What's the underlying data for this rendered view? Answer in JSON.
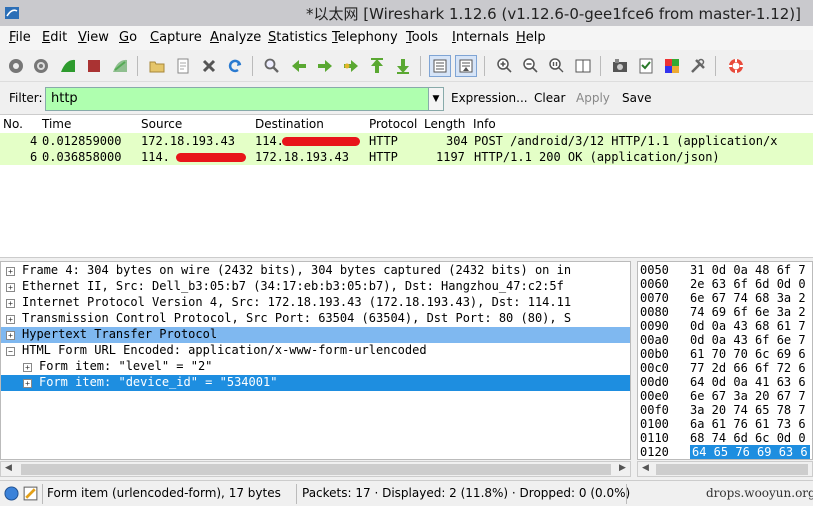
{
  "window": {
    "title": "*以太网   [Wireshark 1.12.6  (v1.12.6-0-gee1fce6 from master-1.12)]"
  },
  "menu": [
    "File",
    "Edit",
    "View",
    "Go",
    "Capture",
    "Analyze",
    "Statistics",
    "Telephony",
    "Tools",
    "Internals",
    "Help"
  ],
  "toolbar_icons": [
    "interface-list-icon",
    "capture-options-icon",
    "start-capture-icon",
    "stop-capture-icon",
    "restart-capture-icon",
    "open-file-icon",
    "save-file-icon",
    "close-file-icon",
    "reload-icon",
    "find-icon",
    "go-back-icon",
    "go-forward-icon",
    "go-to-packet-icon",
    "first-packet-icon",
    "last-packet-icon",
    "colorize-icon",
    "autoscroll-icon",
    "zoom-in-icon",
    "zoom-out-icon",
    "zoom-normal-icon",
    "resize-columns-icon",
    "capture-filters-icon",
    "display-filters-icon",
    "coloring-rules-icon",
    "preferences-icon",
    "help-icon"
  ],
  "filter": {
    "label": "Filter:",
    "value": "http",
    "expression": "Expression...",
    "clear": "Clear",
    "apply": "Apply",
    "save": "Save",
    "bg_color": "#afffaf"
  },
  "packet_list": {
    "columns": [
      "No.",
      "Time",
      "Source",
      "Destination",
      "Protocol",
      "Length",
      "Info"
    ],
    "rows": [
      {
        "no": "4",
        "time": "0.012859000",
        "source": "172.18.193.43",
        "destination": "114.",
        "protocol": "HTTP",
        "length": "304",
        "info": "POST /android/3/12 HTTP/1.1  (application/x"
      },
      {
        "no": "6",
        "time": "0.036858000",
        "source": "114.",
        "destination": "172.18.193.43",
        "protocol": "HTTP",
        "length": "1197",
        "info": "HTTP/1.1 200 OK  (application/json)"
      }
    ],
    "row_color": "#e4ffc7"
  },
  "details": [
    {
      "text": "Frame 4: 304 bytes on wire (2432 bits), 304 bytes captured (2432 bits) on in",
      "indent": 0,
      "exp": "+",
      "sel": ""
    },
    {
      "text": "Ethernet II, Src: Dell_b3:05:b7 (34:17:eb:b3:05:b7), Dst: Hangzhou_47:c2:5f",
      "indent": 0,
      "exp": "+",
      "sel": ""
    },
    {
      "text": "Internet Protocol Version 4, Src: 172.18.193.43 (172.18.193.43), Dst: 114.11",
      "indent": 0,
      "exp": "+",
      "sel": ""
    },
    {
      "text": "Transmission Control Protocol, Src Port: 63504 (63504), Dst Port: 80 (80), S",
      "indent": 0,
      "exp": "+",
      "sel": ""
    },
    {
      "text": "Hypertext Transfer Protocol",
      "indent": 0,
      "exp": "+",
      "sel": "light"
    },
    {
      "text": "HTML Form URL Encoded: application/x-www-form-urlencoded",
      "indent": 0,
      "exp": "−",
      "sel": ""
    },
    {
      "text": "Form item: \"level\" = \"2\"",
      "indent": 1,
      "exp": "+",
      "sel": ""
    },
    {
      "text": "Form item: \"device_id\" = \"534001\"",
      "indent": 1,
      "exp": "+",
      "sel": "dark"
    }
  ],
  "hex": [
    {
      "off": "0050",
      "bytes": "31 0d 0a 48 6f 7",
      "sel": false
    },
    {
      "off": "0060",
      "bytes": "2e 63 6f 6d 0d 0",
      "sel": false
    },
    {
      "off": "0070",
      "bytes": "6e 67 74 68 3a 2",
      "sel": false
    },
    {
      "off": "0080",
      "bytes": "74 69 6f 6e 3a 2",
      "sel": false
    },
    {
      "off": "0090",
      "bytes": "0d 0a 43 68 61 7",
      "sel": false
    },
    {
      "off": "00a0",
      "bytes": "0d 0a 43 6f 6e 7",
      "sel": false
    },
    {
      "off": "00b0",
      "bytes": "61 70 70 6c 69 6",
      "sel": false
    },
    {
      "off": "00c0",
      "bytes": "77 2d 66 6f 72 6",
      "sel": false
    },
    {
      "off": "00d0",
      "bytes": "64 0d 0a 41 63 6",
      "sel": false
    },
    {
      "off": "00e0",
      "bytes": "6e 67 3a 20 67 7",
      "sel": false
    },
    {
      "off": "00f0",
      "bytes": "3a 20 74 65 78 7",
      "sel": false
    },
    {
      "off": "0100",
      "bytes": "6a 61 76 61 73 6",
      "sel": false
    },
    {
      "off": "0110",
      "bytes": "68 74 6d 6c 0d 0",
      "sel": false
    },
    {
      "off": "0120",
      "bytes": "64 65 76 69 63 6",
      "sel": true
    }
  ],
  "status": {
    "field": "Form item (urlencoded-form), 17 bytes",
    "packets": "Packets: 17 · Displayed: 2 (11.8%)  · Dropped: 0 (0.0%)",
    "watermark": "drops.wooyun.org"
  }
}
